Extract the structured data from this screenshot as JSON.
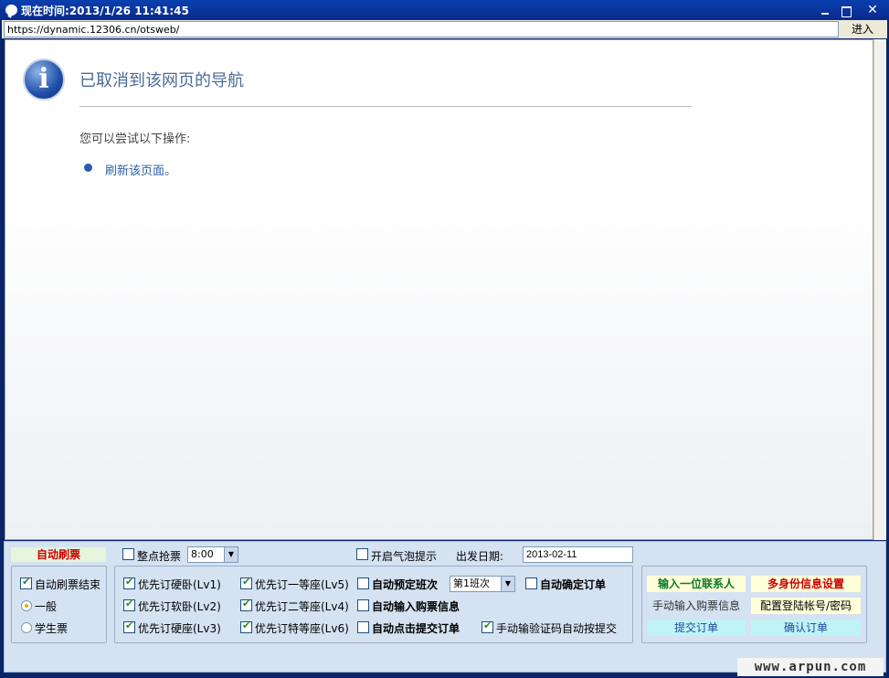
{
  "window": {
    "title": "现在时间:2013/1/26 11:41:45",
    "icon": "chat-bubble-icon"
  },
  "addressbar": {
    "url": "https://dynamic.12306.cn/otsweb/",
    "go_label": "进入"
  },
  "error_page": {
    "title": "已取消到该网页的导航",
    "suggestion": "您可以尝试以下操作:",
    "refresh_link": "刷新该页面。",
    "icon": "info-icon"
  },
  "controls": {
    "auto_refresh": "自动刷票",
    "on_the_hour": {
      "label": "整点抢票",
      "checked": false
    },
    "time_select": "8:00",
    "bubble_tip": {
      "label": "开启气泡提示",
      "checked": false
    },
    "date_label": "出发日期:",
    "date_value": "2013-02-11",
    "refresh_end": {
      "label": "自动刷票结束",
      "checked": true
    },
    "ticket_type": [
      {
        "label": "一般",
        "selected": true
      },
      {
        "label": "学生票",
        "selected": false
      }
    ],
    "seats": [
      {
        "label": "优先订硬卧(Lv1)",
        "checked": true
      },
      {
        "label": "优先订软卧(Lv2)",
        "checked": true
      },
      {
        "label": "优先订硬座(Lv3)",
        "checked": true
      },
      {
        "label": "优先订一等座(Lv5)",
        "checked": true
      },
      {
        "label": "优先订二等座(Lv4)",
        "checked": true
      },
      {
        "label": "优先订特等座(Lv6)",
        "checked": true
      }
    ],
    "auto_book_train": {
      "label": "自动预定班次",
      "checked": false
    },
    "train_select": "第1班次",
    "auto_confirm": {
      "label": "自动确定订单",
      "checked": false
    },
    "auto_input": {
      "label": "自动输入购票信息",
      "checked": false
    },
    "auto_submit": {
      "label": "自动点击提交订单",
      "checked": false
    },
    "captcha_submit": {
      "label": "手动输验证码自动按提交",
      "checked": true
    }
  },
  "actions": {
    "add_contact": "输入一位联系人",
    "multi_identity": "多身份信息设置",
    "manual_input": "手动输入购票信息",
    "config_account": "配置登陆帐号/密码",
    "submit_order": "提交订单",
    "confirm_order": "确认订单"
  },
  "watermark": "www.arpun.com"
}
